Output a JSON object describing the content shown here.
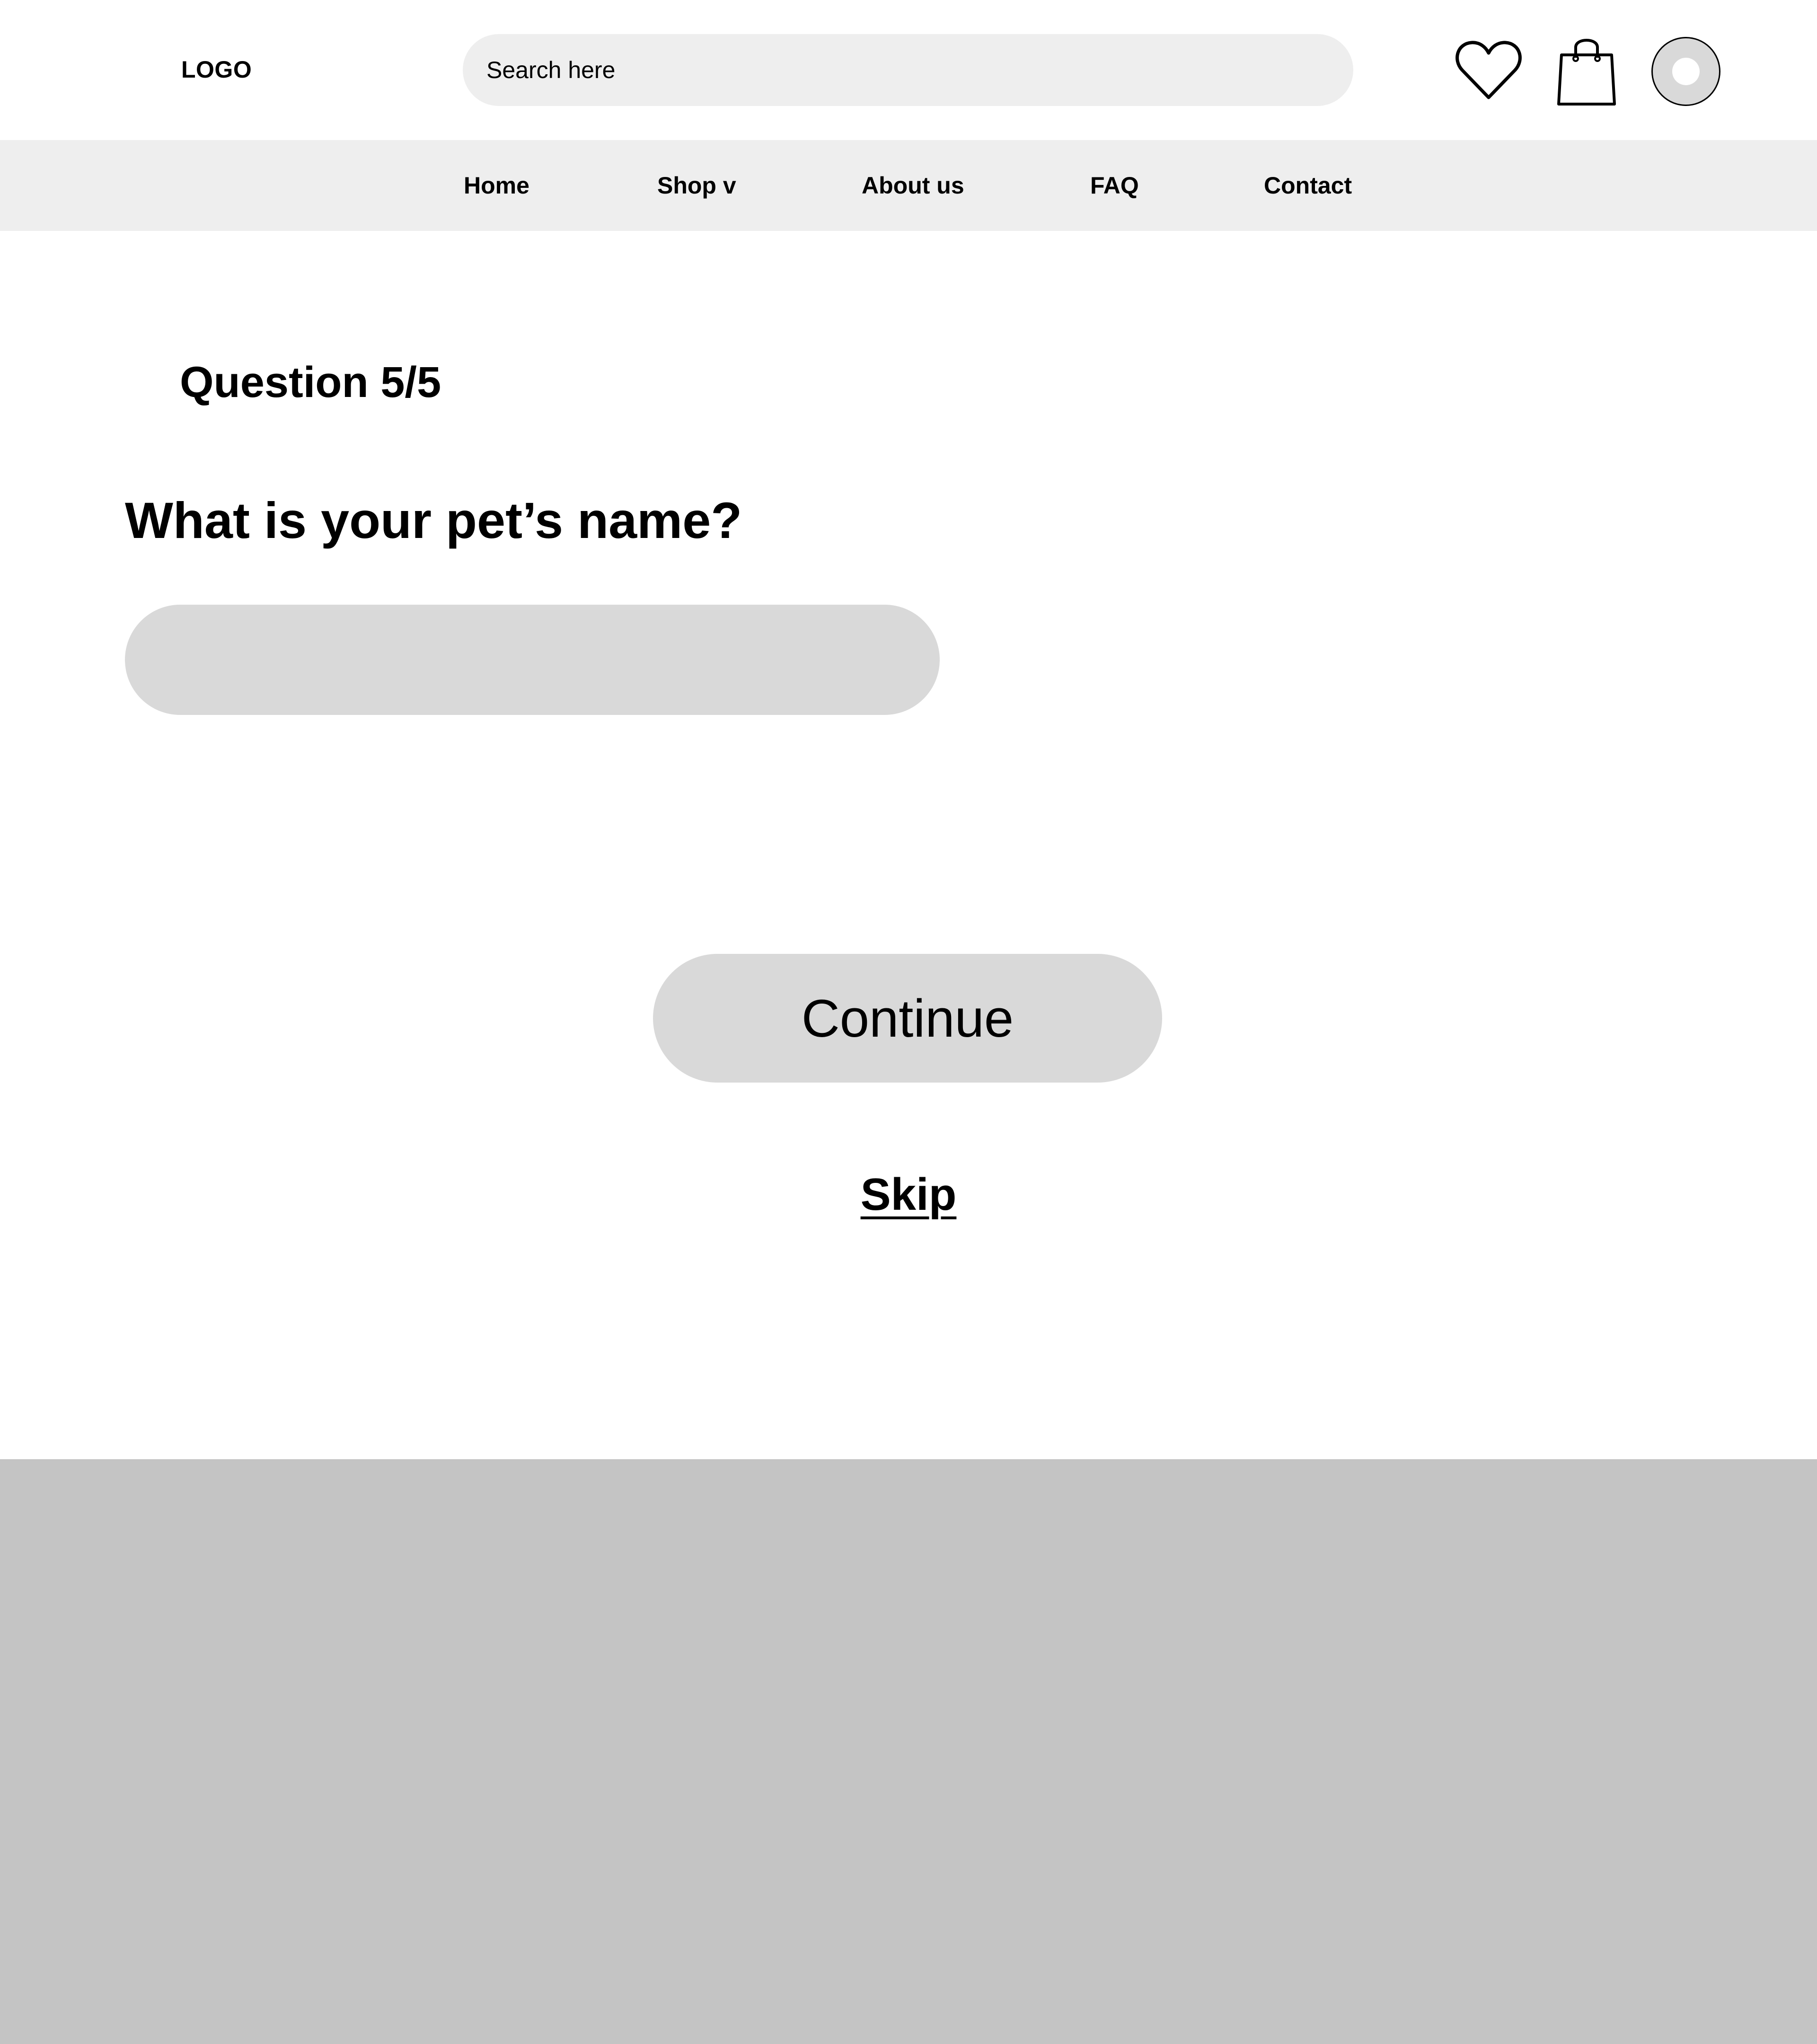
{
  "header": {
    "logo_text": "LOGO",
    "search_placeholder": "Search here",
    "icons": [
      "heart-icon",
      "shopping-bag-icon",
      "avatar"
    ]
  },
  "nav": {
    "items": [
      {
        "label": "Home"
      },
      {
        "label": "Shop v"
      },
      {
        "label": "About us"
      },
      {
        "label": "FAQ"
      },
      {
        "label": "Contact"
      }
    ]
  },
  "quiz": {
    "progress_label": "Question 5/5",
    "question": "What is your pet’s name?",
    "answer_value": "",
    "continue_label": "Continue",
    "skip_label": "Skip"
  },
  "colors": {
    "search_bg": "#eeeeee",
    "nav_bg": "#eeeeee",
    "input_bg": "#d9d9d9",
    "button_bg": "#d9d9d9",
    "footer_bg": "#c4c4c4"
  }
}
